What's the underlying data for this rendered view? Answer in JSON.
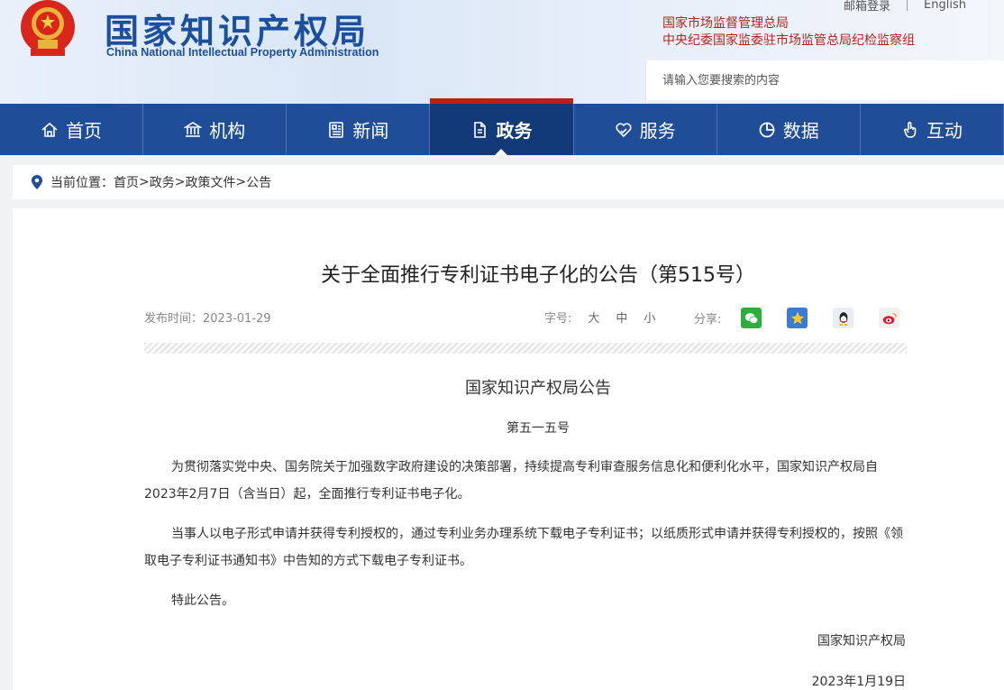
{
  "header": {
    "title": "国家知识产权局",
    "subtitle": "China National Intellectual Property Administration",
    "top_links": {
      "mail_login": "邮箱登录",
      "english": "English"
    },
    "org_links": [
      "国家市场监督管理总局",
      "中央纪委国家监委驻市场监管总局纪检监察组"
    ],
    "search": {
      "placeholder": "请输入您要搜索的内容"
    }
  },
  "nav": {
    "items": [
      {
        "label": "首页",
        "icon": "home-icon"
      },
      {
        "label": "机构",
        "icon": "institution-icon"
      },
      {
        "label": "新闻",
        "icon": "news-icon"
      },
      {
        "label": "政务",
        "icon": "document-icon",
        "active": true
      },
      {
        "label": "服务",
        "icon": "service-icon"
      },
      {
        "label": "数据",
        "icon": "pie-chart-icon"
      },
      {
        "label": "互动",
        "icon": "hand-pointer-icon"
      }
    ]
  },
  "breadcrumb": {
    "prefix": "当前位置：",
    "items": [
      "首页",
      "政务",
      "政策文件",
      "公告"
    ],
    "separator": ">"
  },
  "article": {
    "title": "关于全面推行专利证书电子化的公告（第515号）",
    "publish_label": "发布时间：",
    "publish_date": "2023-01-29",
    "font_size_label": "字号:",
    "font_sizes": [
      "大",
      "中",
      "小"
    ],
    "share_label": "分享:",
    "share_icons": [
      "wechat-icon",
      "qzone-icon",
      "qq-icon",
      "weibo-icon"
    ],
    "doc_title": "国家知识产权局公告",
    "doc_number": "第五一五号",
    "paragraphs": [
      "为贯彻落实党中央、国务院关于加强数字政府建设的决策部署，持续提高专利审查服务信息化和便利化水平，国家知识产权局自2023年2月7日（含当日）起，全面推行专利证书电子化。",
      "当事人以电子形式申请并获得专利授权的，通过专利业务办理系统下载电子专利证书；以纸质形式申请并获得专利授权的，按照《领取电子专利证书通知书》中告知的方式下载电子专利证书。",
      "特此公告。"
    ],
    "signature": "国家知识产权局",
    "signature_date": "2023年1月19日"
  },
  "colors": {
    "brand_blue": "#1f4d97",
    "active_nav": "#133a78",
    "accent_red": "#b3241c"
  }
}
